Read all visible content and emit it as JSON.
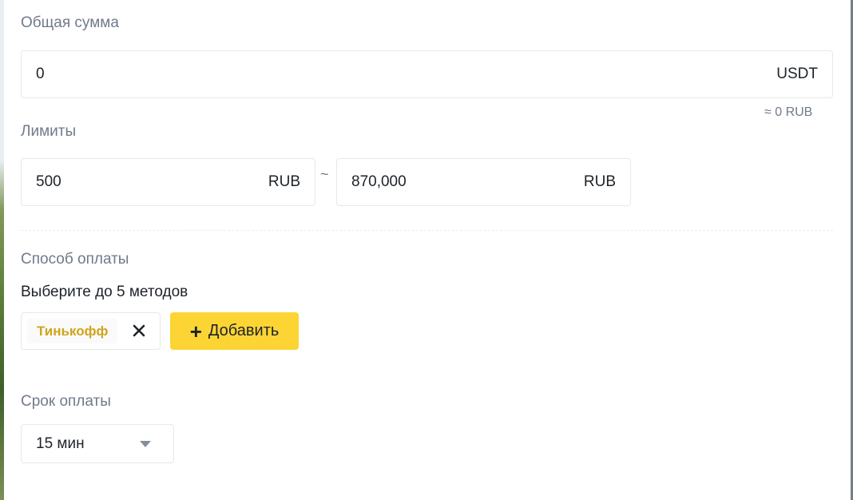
{
  "total": {
    "label": "Общая сумма",
    "value": "0",
    "unit": "USDT",
    "approx": "≈ 0 RUB"
  },
  "limits": {
    "label": "Лимиты",
    "min_value": "500",
    "min_unit": "RUB",
    "separator": "~",
    "max_value": "870,000",
    "max_unit": "RUB"
  },
  "payment": {
    "label": "Способ оплаты",
    "hint": "Выберите до 5 методов",
    "methods": [
      {
        "name": "Тинькофф",
        "color": "#d0a51c"
      }
    ],
    "add_icon": "plus-icon",
    "add_label": "Добавить",
    "add_color": "#fcd535"
  },
  "term": {
    "label": "Срок оплаты",
    "value": "15 мин",
    "icon": "caret-down-icon"
  }
}
